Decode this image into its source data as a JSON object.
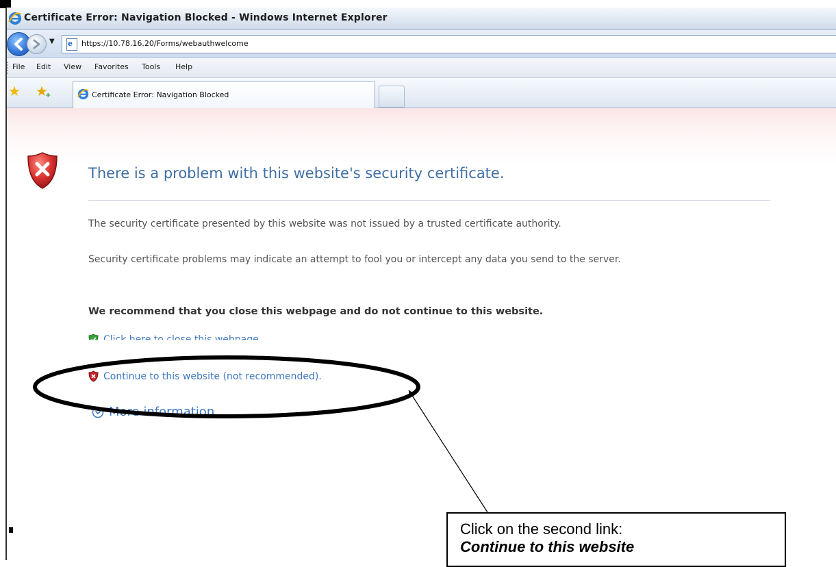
{
  "window": {
    "title": "Certificate Error: Navigation Blocked - Windows Internet Explorer"
  },
  "address_bar": {
    "url": "https://10.78.16.20/Forms/webauthwelcome"
  },
  "menu": {
    "items": [
      "File",
      "Edit",
      "View",
      "Favorites",
      "Tools",
      "Help"
    ]
  },
  "tabs": {
    "active_label": "Certificate Error: Navigation Blocked"
  },
  "page": {
    "heading": "There is a problem with this website's security certificate.",
    "para1": "The security certificate presented by this website was not issued by a trusted certificate authority.",
    "para2": "Security certificate problems may indicate an attempt to fool you or intercept any data you send to the server.",
    "recommend": "We recommend that you close this webpage and do not continue to this website.",
    "close_link": "Click here to close this webpage.",
    "continue_link": "Continue to this website (not recommended).",
    "more_info": "More information"
  },
  "annotation": {
    "callout_line1": "Click on the second link:",
    "callout_line2": "Continue to this website"
  },
  "colors": {
    "link": "#3d78c2",
    "heading": "#3f6fa5",
    "error_red": "#c9242b",
    "ok_green": "#3aa23a"
  }
}
